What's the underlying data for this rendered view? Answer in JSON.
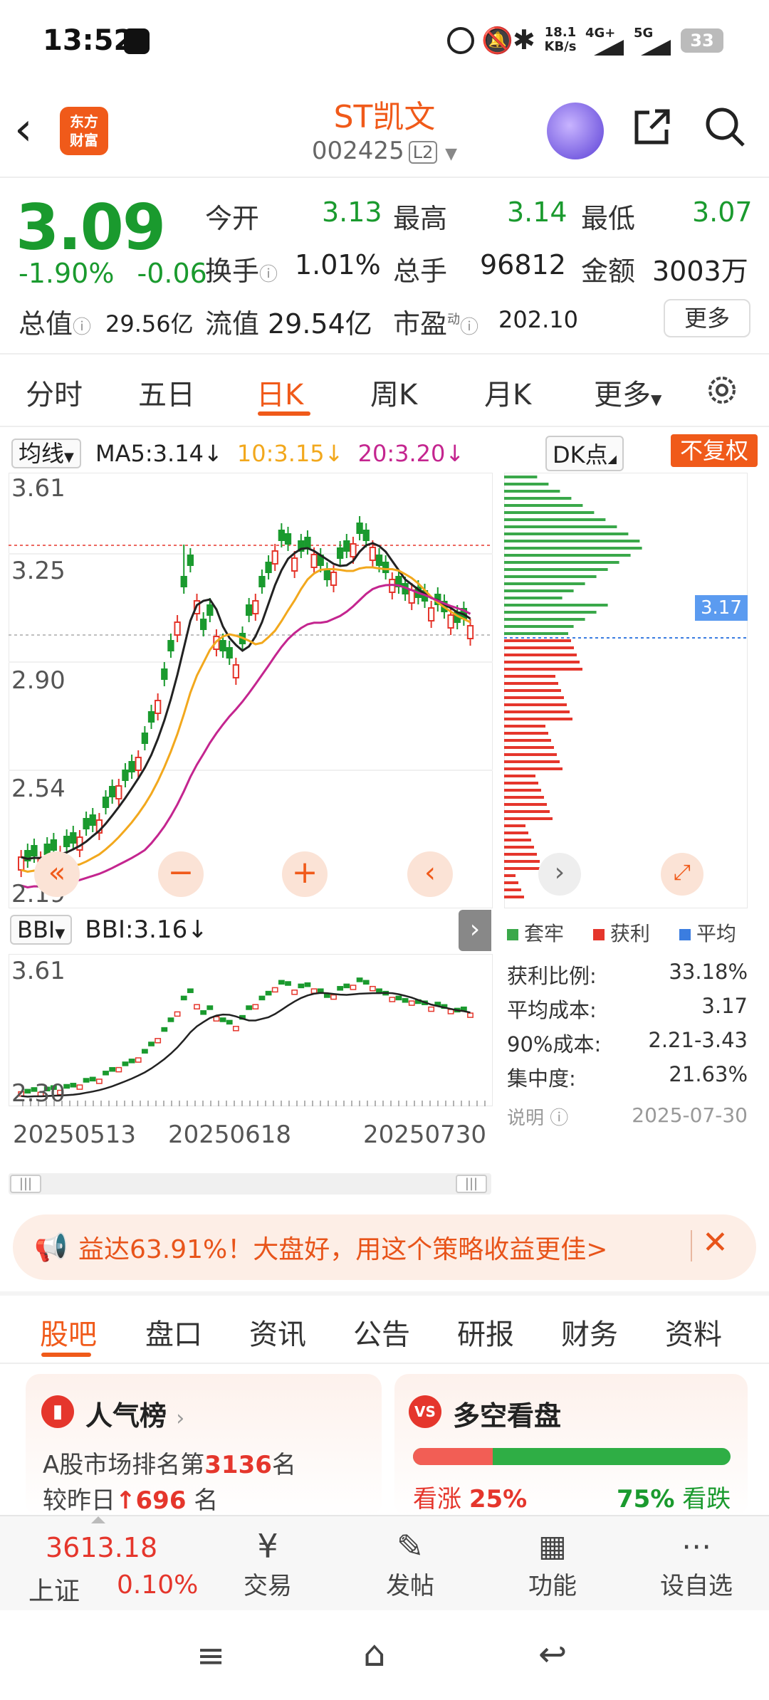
{
  "status": {
    "time": "13:52",
    "net_speed": "18.1\nKB/s",
    "net1": "4G+",
    "net2": "5G",
    "battery": "33"
  },
  "header": {
    "stock_name": "ST凯文",
    "stock_code": "002425",
    "level": "L2",
    "logo_line1": "东方",
    "logo_line2": "财富"
  },
  "quote": {
    "price": "3.09",
    "change_pct": "-1.90%",
    "change": "-0.06",
    "open_label": "今开",
    "open": "3.13",
    "high_label": "最高",
    "high": "3.14",
    "low_label": "最低",
    "low": "3.07",
    "turnover_label": "换手",
    "turnover": "1.01%",
    "volume_label": "总手",
    "volume": "96812",
    "amount_label": "金额",
    "amount": "3003万",
    "mcap_label": "总值",
    "mcap": "29.56亿",
    "float_label": "流值",
    "float": "29.54亿",
    "pe_label": "市盈",
    "pe_sup": "动",
    "pe": "202.10",
    "more": "更多"
  },
  "period_tabs": [
    "分时",
    "五日",
    "日K",
    "周K",
    "月K",
    "更多"
  ],
  "ma": {
    "selector": "均线",
    "ma5": "MA5:3.14",
    "ma10": "10:3.15",
    "ma20": "20:3.20",
    "dk": "DK点",
    "fuquan": "不复权",
    "ma10_color": "#f2a81d",
    "ma20_color": "#c4258f"
  },
  "kline": {
    "y_labels": [
      "3.61",
      "3.25",
      "2.90",
      "2.54",
      "2.19"
    ],
    "chip_price": "3.17"
  },
  "bbi": {
    "selector": "BBI",
    "value": "BBI:3.16",
    "y_top": "3.61",
    "y_bottom": "2.30",
    "dates": [
      "20250513",
      "20250618",
      "20250730"
    ]
  },
  "chip": {
    "legend": [
      "套牢",
      "获利",
      "平均"
    ],
    "rows": [
      {
        "label": "获利比例:",
        "value": "33.18%"
      },
      {
        "label": "平均成本:",
        "value": "3.17"
      },
      {
        "label": "90%成本:",
        "value": "2.21-3.43"
      },
      {
        "label": "集中度:",
        "value": "21.63%"
      }
    ],
    "note_label": "说明",
    "date": "2025-07-30"
  },
  "banner": {
    "text": "益达63.91%！大盘好，用这个策略收益更佳>"
  },
  "bottom_tabs": [
    "股吧",
    "盘口",
    "资讯",
    "公告",
    "研报",
    "财务",
    "资料"
  ],
  "cards": {
    "popularity": {
      "title": "人气榜",
      "line1_pre": "A股市场排名第",
      "rank": "3136",
      "line1_post": "名",
      "line2_pre": "较昨日",
      "delta": "696",
      "line2_post": "名"
    },
    "longshort": {
      "title": "多空看盘",
      "up_label": "看涨",
      "up_pct": "25%",
      "down_pct": "75%",
      "down_label": "看跌",
      "up_ratio": 0.25
    }
  },
  "bottom_nav": {
    "index_value": "3613.18",
    "index_name": "上证",
    "index_change": "0.10%",
    "items": [
      "交易",
      "发帖",
      "功能",
      "设自选"
    ]
  }
}
